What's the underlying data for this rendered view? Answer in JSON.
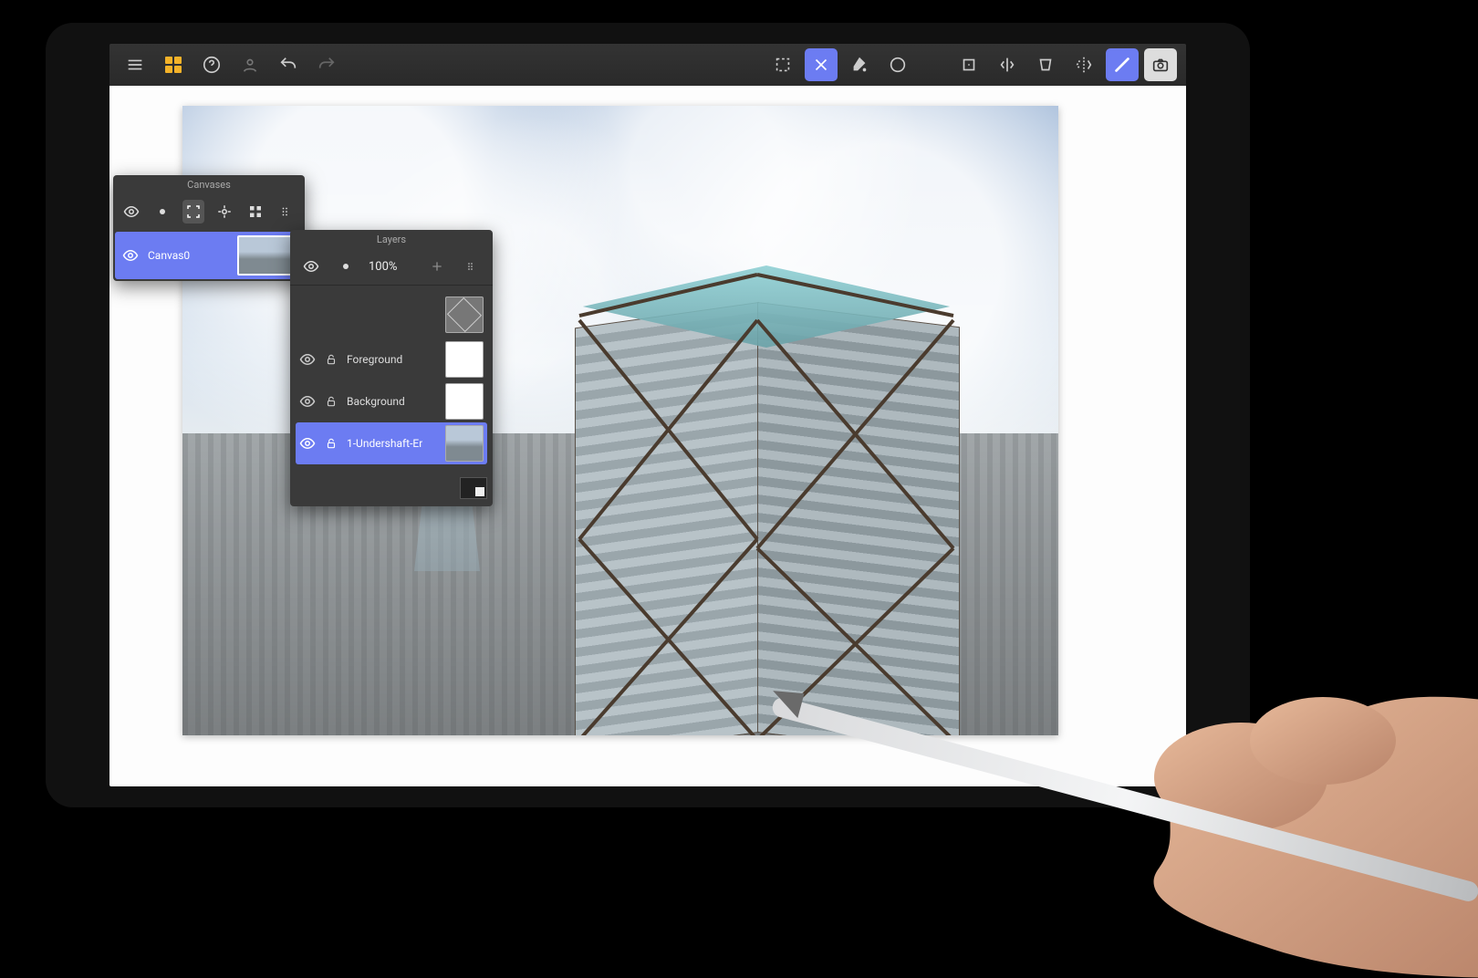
{
  "canvases": {
    "title": "Canvases",
    "item_label": "Canvas0"
  },
  "layers": {
    "title": "Layers",
    "opacity": "100%",
    "items": [
      {
        "name": "Foreground"
      },
      {
        "name": "Background"
      },
      {
        "name": "1-Undershaft-Er"
      }
    ]
  },
  "colors": {
    "accent": "#6c7cf2",
    "amber": "#f3b229"
  }
}
